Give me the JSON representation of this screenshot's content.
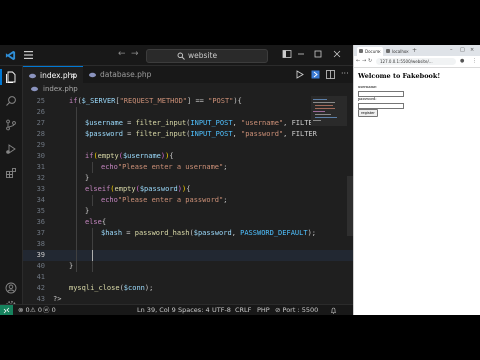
{
  "vscode": {
    "search_text": "website",
    "tabs": [
      {
        "label": "index.php",
        "active": true,
        "close": "×"
      },
      {
        "label": "database.php",
        "active": false
      }
    ],
    "breadcrumb": "index.php",
    "lines": [
      {
        "n": "25",
        "tokens": [
          [
            "k",
            "if"
          ],
          [
            "o",
            "("
          ],
          [
            "v",
            "$_SERVER"
          ],
          [
            "o",
            "["
          ],
          [
            "s",
            "\"REQUEST_METHOD\""
          ],
          [
            "o",
            "] == "
          ],
          [
            "s",
            "\"POST\""
          ],
          [
            "o",
            "){"
          ]
        ],
        "indent": 1
      },
      {
        "n": "26",
        "tokens": [],
        "indent": 0
      },
      {
        "n": "27",
        "tokens": [
          [
            "v",
            "$username"
          ],
          [
            "o",
            " = "
          ],
          [
            "f",
            "filter_input"
          ],
          [
            "o",
            "("
          ],
          [
            "c",
            "INPUT_POST"
          ],
          [
            "o",
            ", "
          ],
          [
            "s",
            "\"username\""
          ],
          [
            "o",
            ", FILTER"
          ]
        ],
        "indent": 2
      },
      {
        "n": "28",
        "tokens": [
          [
            "v",
            "$password"
          ],
          [
            "o",
            " = "
          ],
          [
            "f",
            "filter_input"
          ],
          [
            "o",
            "("
          ],
          [
            "c",
            "INPUT_POST"
          ],
          [
            "o",
            ", "
          ],
          [
            "s",
            "\"password\""
          ],
          [
            "o",
            ", FILTER"
          ]
        ],
        "indent": 2
      },
      {
        "n": "29",
        "tokens": [],
        "indent": 0
      },
      {
        "n": "30",
        "tokens": [
          [
            "k",
            "if"
          ],
          [
            "p",
            "("
          ],
          [
            "f",
            "empty"
          ],
          [
            "b",
            "("
          ],
          [
            "v",
            "$username"
          ],
          [
            "b",
            ")"
          ],
          [
            "p",
            ")"
          ],
          [
            "o",
            "{"
          ]
        ],
        "indent": 2
      },
      {
        "n": "31",
        "tokens": [
          [
            "k",
            "echo"
          ],
          [
            "s",
            "\"Please enter a username\""
          ],
          [
            "o",
            ";"
          ]
        ],
        "indent": 3
      },
      {
        "n": "32",
        "tokens": [
          [
            "o",
            "}"
          ]
        ],
        "indent": 2
      },
      {
        "n": "33",
        "tokens": [
          [
            "k",
            "elseif"
          ],
          [
            "p",
            "("
          ],
          [
            "f",
            "empty"
          ],
          [
            "b",
            "("
          ],
          [
            "v",
            "$password"
          ],
          [
            "b",
            ")"
          ],
          [
            "p",
            ")"
          ],
          [
            "o",
            "{"
          ]
        ],
        "indent": 2
      },
      {
        "n": "34",
        "tokens": [
          [
            "k",
            "echo"
          ],
          [
            "s",
            "\"Please enter a password\""
          ],
          [
            "o",
            ";"
          ]
        ],
        "indent": 3
      },
      {
        "n": "35",
        "tokens": [
          [
            "o",
            "}"
          ]
        ],
        "indent": 2
      },
      {
        "n": "36",
        "tokens": [
          [
            "k",
            "else"
          ],
          [
            "o",
            "{"
          ]
        ],
        "indent": 2
      },
      {
        "n": "37",
        "tokens": [
          [
            "v",
            "$hash"
          ],
          [
            "o",
            " = "
          ],
          [
            "f",
            "password_hash"
          ],
          [
            "o",
            "("
          ],
          [
            "v",
            "$password"
          ],
          [
            "o",
            ", "
          ],
          [
            "c",
            "PASSWORD_DEFAULT"
          ],
          [
            "o",
            ");"
          ]
        ],
        "indent": 3
      },
      {
        "n": "38",
        "tokens": [],
        "indent": 0
      },
      {
        "n": "39",
        "tokens": [],
        "indent": 0,
        "current": true
      },
      {
        "n": "40",
        "tokens": [
          [
            "o",
            "}"
          ]
        ],
        "indent": 1
      },
      {
        "n": "41",
        "tokens": [],
        "indent": 0
      },
      {
        "n": "42",
        "tokens": [
          [
            "f",
            "mysqli_close"
          ],
          [
            "o",
            "("
          ],
          [
            "v",
            "$conn"
          ],
          [
            "o",
            ");"
          ]
        ],
        "indent": 1
      },
      {
        "n": "43",
        "tokens": [
          [
            "o",
            "?>"
          ]
        ],
        "indent": 0
      }
    ],
    "status": {
      "errors": "⊗ 0",
      "warnings": "⚠ 0",
      "ports": "ⓦ 0",
      "position": "Ln 39, Col 9",
      "spaces": "Spaces: 4",
      "encoding": "UTF-8",
      "eol": "CRLF",
      "language": "PHP",
      "port": "⊘ Port : 5500"
    },
    "accent_color": "#0078d4"
  },
  "browser": {
    "tabs": [
      {
        "label": "Docum",
        "close": "×",
        "active": true
      },
      {
        "label": "localho",
        "close": "×",
        "active": false
      }
    ],
    "new_tab": "+",
    "window_controls": [
      "–",
      "□",
      "×"
    ],
    "url": "127.0.0.1:5500/website/...",
    "page": {
      "heading": "Welcome to Fakebook!",
      "username_label": "username:",
      "password_label": "password:",
      "submit_label": "register"
    }
  }
}
